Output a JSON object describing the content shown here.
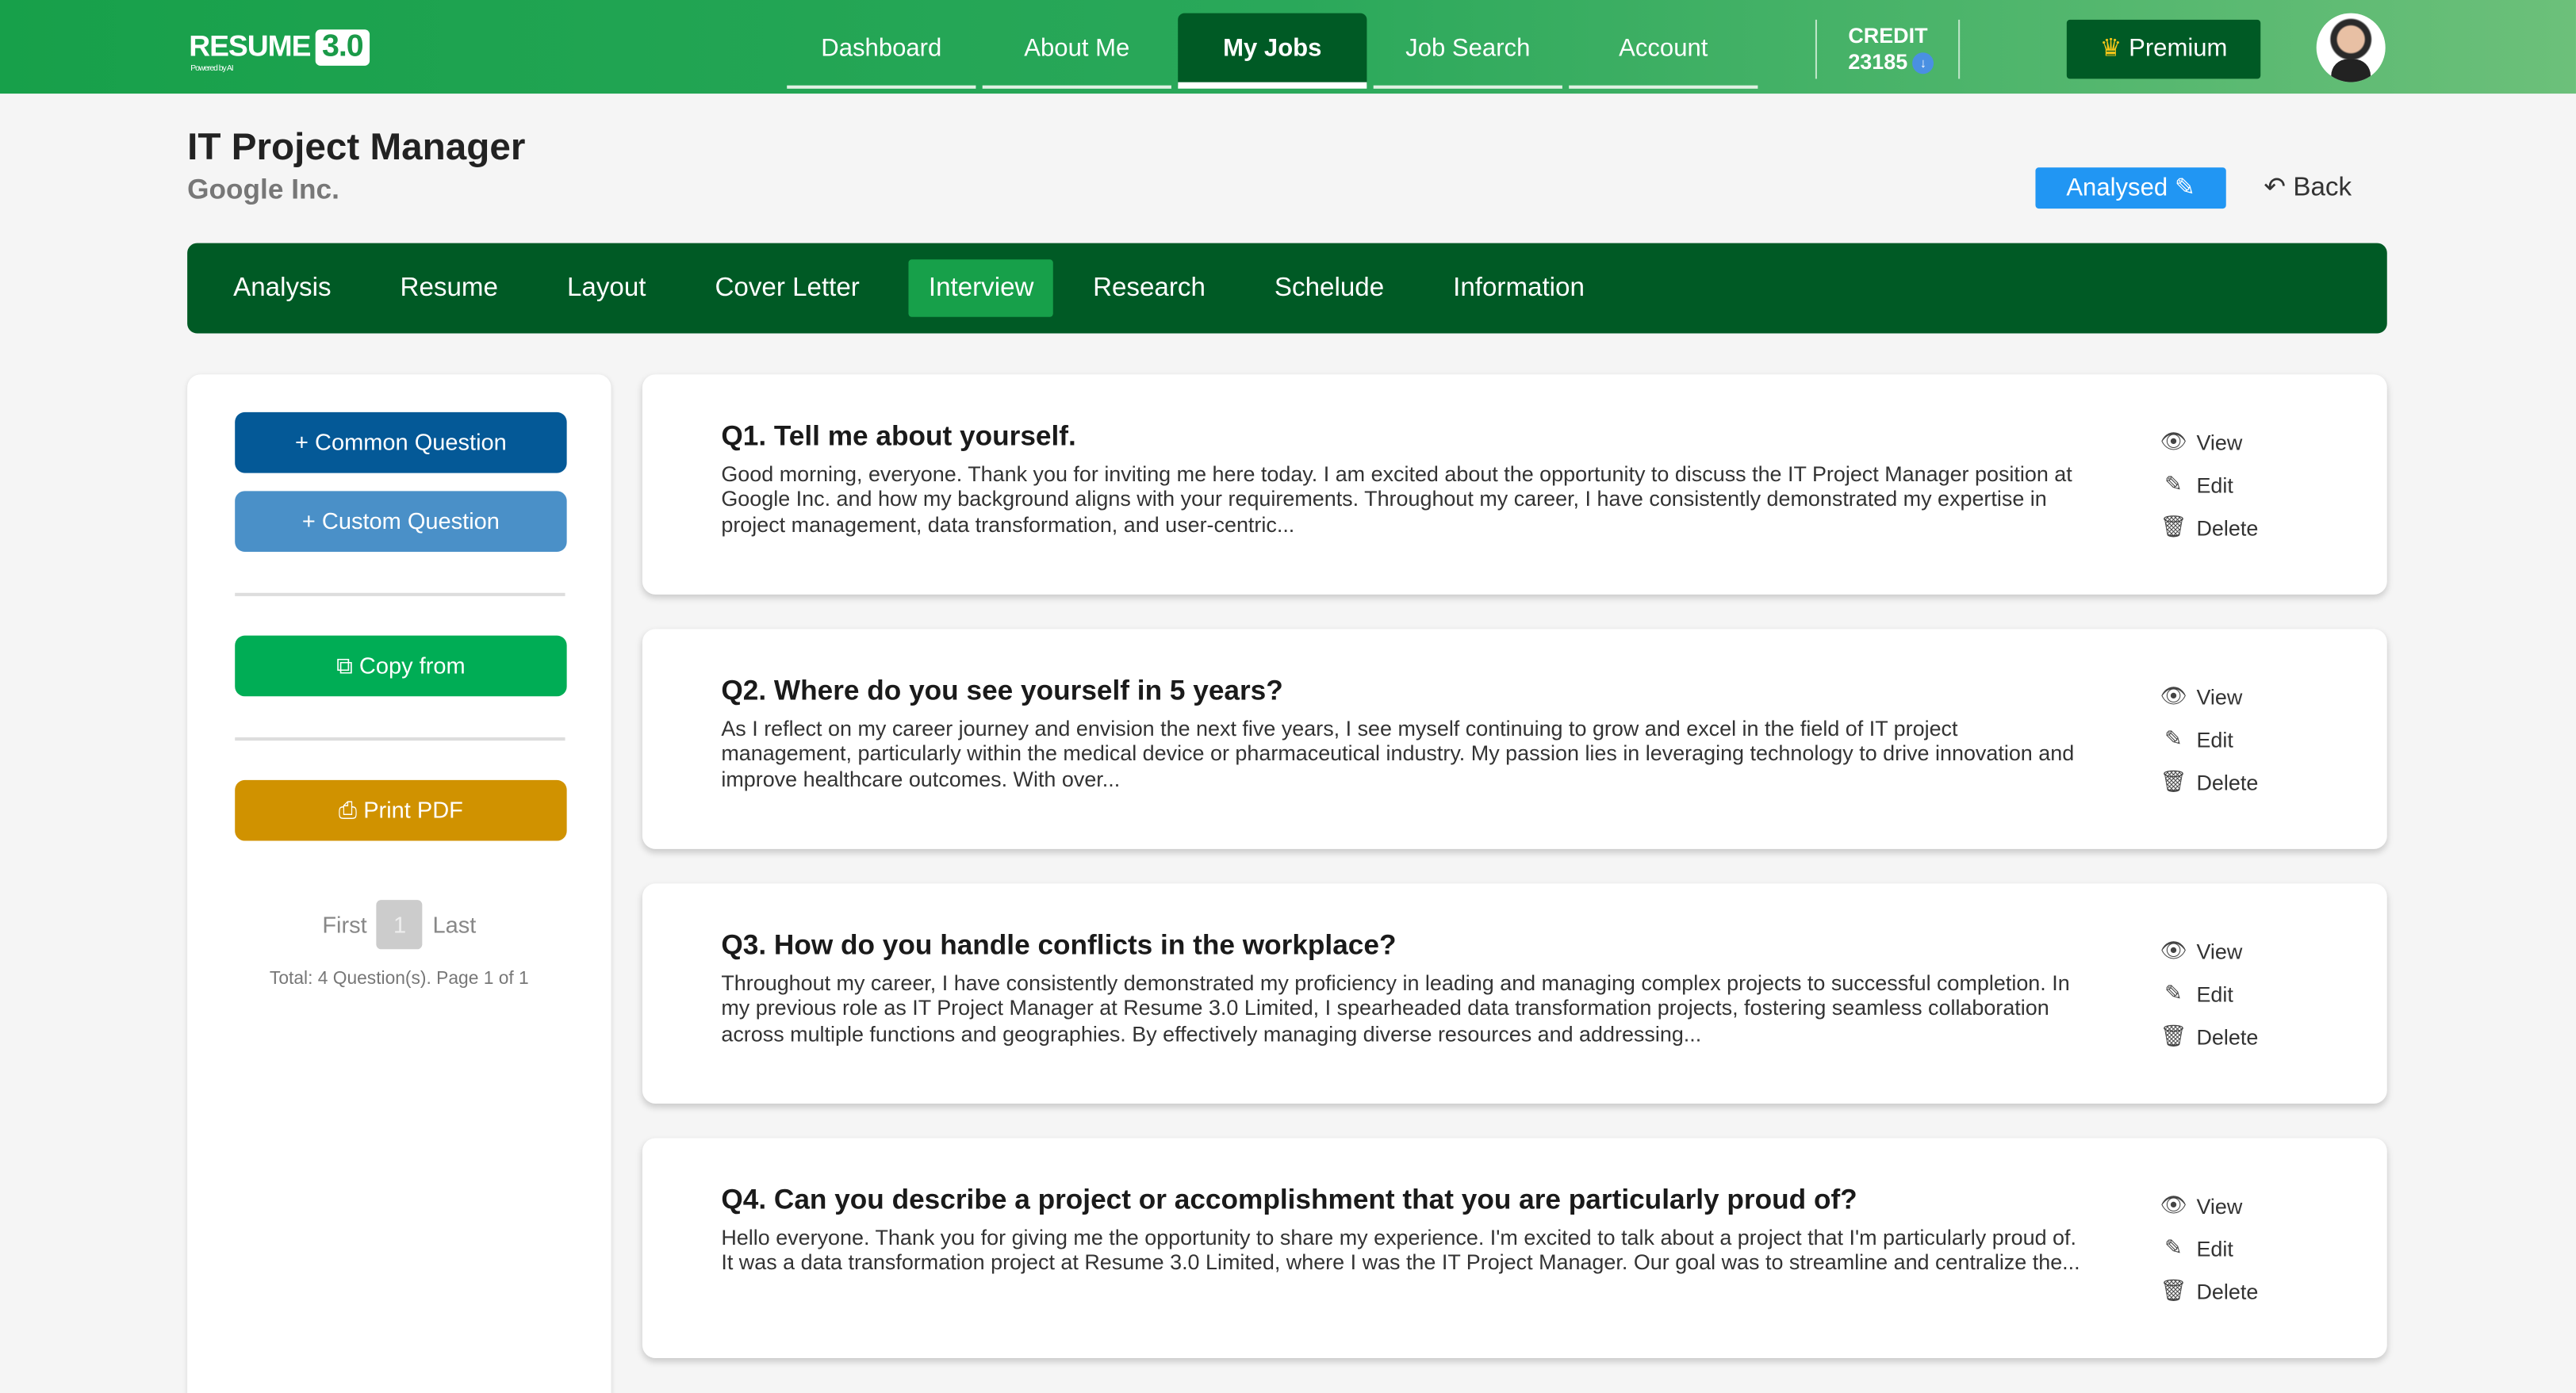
{
  "brand": {
    "name": "RESUME",
    "version": "3.0",
    "tagline": "Powered by AI"
  },
  "nav": [
    {
      "label": "Dashboard"
    },
    {
      "label": "About Me"
    },
    {
      "label": "My Jobs",
      "active": true
    },
    {
      "label": "Job Search"
    },
    {
      "label": "Account"
    }
  ],
  "credit": {
    "label": "CREDIT",
    "value": "23185"
  },
  "premium": {
    "label": "Premium",
    "icon": "crown-icon"
  },
  "job": {
    "title": "IT Project Manager",
    "company": "Google Inc."
  },
  "status": {
    "label": "Analysed",
    "icon": "pencil-icon"
  },
  "back": {
    "label": "Back",
    "icon": "undo-icon"
  },
  "tabs": [
    {
      "label": "Analysis"
    },
    {
      "label": "Resume"
    },
    {
      "label": "Layout"
    },
    {
      "label": "Cover Letter"
    },
    {
      "label": "Interview",
      "active": true
    },
    {
      "label": "Research"
    },
    {
      "label": "Schelude"
    },
    {
      "label": "Information"
    }
  ],
  "sidebar": {
    "common": "Common Question",
    "custom": "Custom Question",
    "copy": "Copy from",
    "print": "Print PDF",
    "first": "First",
    "page": "1",
    "last": "Last",
    "total": "Total: 4 Question(s). Page 1 of 1"
  },
  "actions": {
    "view": "View",
    "edit": "Edit",
    "delete": "Delete"
  },
  "questions": [
    {
      "title": "Q1. Tell me about yourself.",
      "text": "Good morning, everyone. Thank you for inviting me here today. I am excited about the opportunity to discuss the IT Project Manager position at Google Inc. and how my background aligns with your requirements. Throughout my career, I have consistently demonstrated my expertise in project management, data transformation, and user-centric..."
    },
    {
      "title": "Q2. Where do you see yourself in 5 years?",
      "text": "As I reflect on my career journey and envision the next five years, I see myself continuing to grow and excel in the field of IT project management, particularly within the medical device or pharmaceutical industry. My passion lies in leveraging technology to drive innovation and improve healthcare outcomes. With over..."
    },
    {
      "title": "Q3. How do you handle conflicts in the workplace?",
      "text": "Throughout my career, I have consistently demonstrated my proficiency in leading and managing complex projects to successful completion. In my previous role as IT Project Manager at Resume 3.0 Limited, I spearheaded data transformation projects, fostering seamless collaboration across multiple functions and geographies. By effectively managing diverse resources and addressing..."
    },
    {
      "title": "Q4. Can you describe a project or accomplishment that you are particularly proud of?",
      "text": "Hello everyone. Thank you for giving me the opportunity to share my experience. I'm excited to talk about a project that I'm particularly proud of. It was a data transformation project at Resume 3.0 Limited, where I was the IT Project Manager. Our goal was to streamline and centralize the..."
    }
  ],
  "colors": {
    "header": "#17a04a",
    "dark_green": "#005a25",
    "common_btn": "#045997",
    "custom_btn": "#4a90c8",
    "copy_btn": "#00ad55",
    "print_btn": "#d09200",
    "analysed": "#2196f3"
  }
}
